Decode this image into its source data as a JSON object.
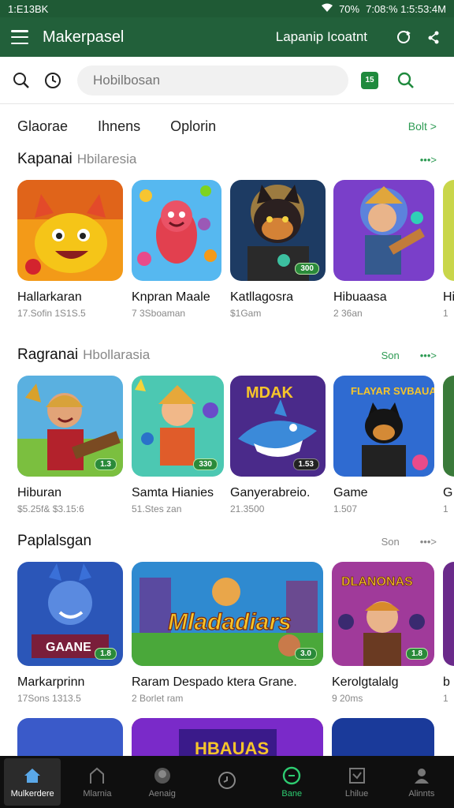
{
  "status": {
    "time": "1:E13BK",
    "right": "7:08:% 1:5:53:4M",
    "battery": "70%"
  },
  "appbar": {
    "title": "Makerpasel",
    "link": "Lapanip Icoatnt"
  },
  "search": {
    "placeholder": "Hobilbosan",
    "badge": "15"
  },
  "tabs": {
    "items": [
      "Glaorae",
      "Ihnens",
      "Oplorin"
    ],
    "more": "Bolt >"
  },
  "sections": [
    {
      "title": "Kapanai",
      "subtitle": "Hbilaresia",
      "see": "",
      "arrow": "•••>",
      "cards": [
        {
          "name": "Hallarkaran",
          "meta": "17.Sofin 1S1S.5",
          "tag": ""
        },
        {
          "name": "Knpran Maale",
          "meta": "7 3Sboaman",
          "tag": ""
        },
        {
          "name": "Katllagosra",
          "meta": "$1Gam",
          "tag": "300"
        },
        {
          "name": "Hibuaasa",
          "meta": "2 36an",
          "tag": ""
        },
        {
          "name": "Hi",
          "meta": "1",
          "tag": ""
        }
      ]
    },
    {
      "title": "Ragranai",
      "subtitle": "Hbollarasia",
      "see": "Son",
      "arrow": "•••>",
      "cards": [
        {
          "name": "Hiburan",
          "meta": "$5.25f& $3.15:6",
          "tag": "1.3"
        },
        {
          "name": "Samta Hianies",
          "meta": "51.Stes zan",
          "tag": "330"
        },
        {
          "name": "Ganyerabreio.",
          "meta": "21.3500",
          "tag": "1.53"
        },
        {
          "name": "Game",
          "meta": "1.507",
          "tag": ""
        },
        {
          "name": "G",
          "meta": "1",
          "tag": ""
        }
      ]
    },
    {
      "title": "Paplalsgan",
      "subtitle": "",
      "see": "Son",
      "arrow": "•••>",
      "cards": [
        {
          "name": "Markarprinn",
          "meta": "17Sons 1313.5",
          "tag": "1.8",
          "art": "GAANE"
        },
        {
          "name": "Raram Despado ktera Grane.",
          "meta": "2 Borlet ram",
          "tag": "3.0",
          "art": "Mladadiars"
        },
        {
          "name": "Kerolgtalalg",
          "meta": "9 20ms",
          "tag": "1.8",
          "art": "DLANONAS"
        },
        {
          "name": "b",
          "meta": "1",
          "tag": ""
        }
      ]
    }
  ],
  "peek": {
    "banner": "HBAUAS"
  },
  "titles": {
    "dark_banner": "MDAK",
    "blue_banner": "FLAYAR SVBAUAS"
  },
  "nav": [
    {
      "label": "Mulkerdere",
      "icon": "home-icon"
    },
    {
      "label": "Mlarnia",
      "icon": "store-icon"
    },
    {
      "label": "Aenaig",
      "icon": "avatar-icon"
    },
    {
      "label": "",
      "icon": "clock-icon"
    },
    {
      "label": "Bane",
      "icon": "circle-icon"
    },
    {
      "label": "Lhilue",
      "icon": "check-icon"
    },
    {
      "label": "Alinnts",
      "icon": "person-icon"
    }
  ]
}
